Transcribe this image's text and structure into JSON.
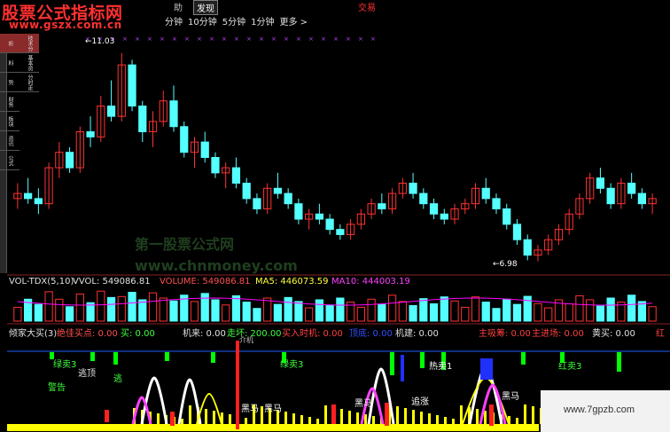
{
  "header": {
    "site_title": "股票公式指标网",
    "site_url": "www.gszx.com.cn",
    "menu_partial": "助",
    "menu_discover": "发现",
    "menu_trade": "交易"
  },
  "periods": [
    "分钟",
    "10分钟",
    "5分钟",
    "1分钟",
    "更多 >"
  ],
  "left_tabs": [
    "技术分析",
    "基本资料",
    "分时走势",
    "财务",
    "板块",
    "资讯",
    "公式"
  ],
  "price_chart": {
    "high_label": "11.03",
    "low_label": "6.98"
  },
  "watermark": {
    "line1": "第一股票公式网",
    "line2": "www.chnmoney.com"
  },
  "vol_panel": {
    "title": "VOL-TDX(5,10)",
    "vvol": "VVOL: 549086.81",
    "volume": "VOLUME: 549086.81",
    "ma5": "MA5: 446073.59",
    "ma10": "MA10: 444003.19"
  },
  "ind_panel": {
    "title": "倾家大买(3)",
    "best_buy": "绝佳买点: 0.00",
    "buy": "买: 0.00",
    "jilai": "机来: 0.00",
    "zoubad": "走坏: 200.00",
    "buytime": "买入时机: 0.00",
    "tag1": "顶底: 0.00",
    "jijian": "机建: 0.00",
    "main_chips": "主吸筹: 0.00",
    "main_in": "主进场: 0.00",
    "yellow_buy": "黄买: 0.00",
    "red_edge": "红",
    "sub_label": "介机"
  },
  "annotations": {
    "green_sell": "绿卖3",
    "escape_top": "逃顶",
    "escape": "逃",
    "warn": "警告",
    "black_horse": "黑马",
    "chase": "追涨",
    "red_sell": "红卖3",
    "hot_buy": "热卖1"
  },
  "footer_badge": "www.7gpzb.com",
  "colors": {
    "up": "#ff3232",
    "down": "#54ffff",
    "ma": "#ff00ff",
    "yellow": "#ffff00",
    "green": "#00ff00",
    "pink": "#ff40ff"
  },
  "chart_data": {
    "type": "candlestick",
    "price_labels": [
      "11.03",
      "6.98"
    ],
    "candles": [
      [
        8.2,
        8.5,
        8.0,
        8.3
      ],
      [
        8.3,
        8.6,
        8.1,
        8.2
      ],
      [
        8.2,
        8.4,
        7.9,
        8.1
      ],
      [
        8.1,
        8.9,
        8.0,
        8.8
      ],
      [
        8.8,
        9.3,
        8.6,
        9.1
      ],
      [
        9.1,
        9.2,
        8.7,
        8.8
      ],
      [
        8.8,
        9.6,
        8.7,
        9.5
      ],
      [
        9.5,
        9.8,
        9.2,
        9.4
      ],
      [
        9.4,
        10.2,
        9.3,
        10.0
      ],
      [
        10.0,
        10.5,
        9.7,
        9.8
      ],
      [
        9.8,
        11.03,
        9.7,
        10.8
      ],
      [
        10.8,
        10.9,
        9.9,
        10.0
      ],
      [
        10.0,
        10.1,
        9.3,
        9.5
      ],
      [
        9.5,
        9.9,
        9.2,
        9.7
      ],
      [
        9.7,
        10.3,
        9.6,
        10.1
      ],
      [
        10.1,
        10.4,
        9.5,
        9.6
      ],
      [
        9.6,
        9.7,
        9.0,
        9.1
      ],
      [
        9.1,
        9.4,
        8.8,
        9.3
      ],
      [
        9.3,
        9.5,
        8.9,
        9.0
      ],
      [
        9.0,
        9.1,
        8.6,
        8.7
      ],
      [
        8.7,
        8.9,
        8.4,
        8.8
      ],
      [
        8.8,
        9.0,
        8.4,
        8.5
      ],
      [
        8.5,
        8.6,
        8.1,
        8.2
      ],
      [
        8.2,
        8.3,
        7.9,
        8.0
      ],
      [
        8.0,
        8.5,
        7.9,
        8.4
      ],
      [
        8.4,
        8.7,
        8.2,
        8.3
      ],
      [
        8.3,
        8.4,
        8.0,
        8.1
      ],
      [
        8.1,
        8.2,
        7.7,
        7.8
      ],
      [
        7.8,
        8.0,
        7.6,
        7.9
      ],
      [
        7.9,
        8.1,
        7.7,
        7.8
      ],
      [
        7.8,
        7.9,
        7.5,
        7.6
      ],
      [
        7.6,
        7.7,
        7.4,
        7.5
      ],
      [
        7.5,
        7.8,
        7.4,
        7.7
      ],
      [
        7.7,
        8.0,
        7.6,
        7.9
      ],
      [
        7.9,
        8.2,
        7.8,
        8.1
      ],
      [
        8.1,
        8.3,
        7.9,
        8.0
      ],
      [
        8.0,
        8.4,
        7.9,
        8.3
      ],
      [
        8.3,
        8.6,
        8.2,
        8.5
      ],
      [
        8.5,
        8.7,
        8.2,
        8.3
      ],
      [
        8.3,
        8.4,
        8.0,
        8.1
      ],
      [
        8.1,
        8.2,
        7.8,
        7.9
      ],
      [
        7.9,
        8.0,
        7.7,
        7.8
      ],
      [
        7.8,
        8.1,
        7.7,
        8.0
      ],
      [
        8.0,
        8.2,
        7.9,
        8.1
      ],
      [
        8.1,
        8.5,
        8.0,
        8.4
      ],
      [
        8.4,
        8.6,
        8.1,
        8.2
      ],
      [
        8.2,
        8.3,
        7.9,
        8.0
      ],
      [
        8.0,
        8.1,
        7.6,
        7.7
      ],
      [
        7.7,
        7.8,
        7.3,
        7.4
      ],
      [
        7.4,
        7.5,
        7.0,
        7.1
      ],
      [
        7.1,
        7.3,
        6.98,
        7.2
      ],
      [
        7.2,
        7.5,
        7.1,
        7.4
      ],
      [
        7.4,
        7.7,
        7.3,
        7.6
      ],
      [
        7.6,
        8.0,
        7.5,
        7.9
      ],
      [
        7.9,
        8.3,
        7.8,
        8.2
      ],
      [
        8.2,
        8.7,
        8.1,
        8.6
      ],
      [
        8.6,
        8.8,
        8.3,
        8.4
      ],
      [
        8.4,
        8.5,
        8.0,
        8.1
      ],
      [
        8.1,
        8.6,
        8.0,
        8.5
      ],
      [
        8.5,
        8.7,
        8.2,
        8.3
      ],
      [
        8.3,
        8.4,
        8.0,
        8.1
      ],
      [
        8.1,
        8.3,
        7.9,
        8.2
      ]
    ]
  }
}
